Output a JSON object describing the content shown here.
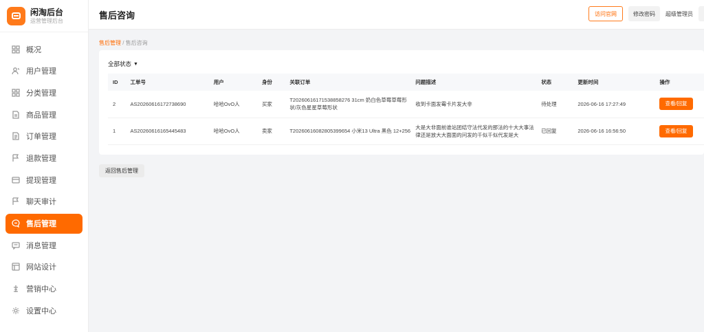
{
  "brand": {
    "title": "闲淘后台",
    "subtitle": "运营管理后台"
  },
  "sidebar": {
    "items": [
      {
        "label": "概况",
        "icon": "grid-icon",
        "active": false
      },
      {
        "label": "用户管理",
        "icon": "user-icon",
        "active": false
      },
      {
        "label": "分类管理",
        "icon": "category-icon",
        "active": false
      },
      {
        "label": "商品管理",
        "icon": "product-icon",
        "active": false
      },
      {
        "label": "订单管理",
        "icon": "order-icon",
        "active": false
      },
      {
        "label": "退款管理",
        "icon": "flag-icon",
        "active": false
      },
      {
        "label": "提现管理",
        "icon": "card-icon",
        "active": false
      },
      {
        "label": "聊天审计",
        "icon": "flag-icon",
        "active": false
      },
      {
        "label": "售后管理",
        "icon": "chat-bubble-icon",
        "active": true
      },
      {
        "label": "消息管理",
        "icon": "message-icon",
        "active": false
      },
      {
        "label": "网站设计",
        "icon": "layout-icon",
        "active": false
      },
      {
        "label": "营销中心",
        "icon": "marketing-icon",
        "active": false
      },
      {
        "label": "设置中心",
        "icon": "gear-icon",
        "active": false
      }
    ]
  },
  "header": {
    "title": "售后咨询",
    "visit_site": "访问官网",
    "change_password": "修改密码",
    "admin": "超级管理员"
  },
  "breadcrumb": {
    "parent": "售后管理",
    "separator": " / ",
    "current": "售后咨询"
  },
  "filter": {
    "status_label": "全部状态"
  },
  "table": {
    "columns": [
      "ID",
      "工单号",
      "用户",
      "身份",
      "关联订单",
      "问题描述",
      "状态",
      "更新时间",
      "操作"
    ],
    "rows": [
      {
        "id": "2",
        "ticket": "AS20260616172738690",
        "user": "哈哈OvO人",
        "role": "买家",
        "order": "T20260616171538858276 31cm 奶白色草莓草莓形状/灰色星星草莓形状",
        "issue": "收到卡面发霉卡片发大非",
        "status": "待处理",
        "updated": "2026-06-16 17:27:49",
        "action": "查看/回复"
      },
      {
        "id": "1",
        "ticket": "AS20260616165445483",
        "user": "哈哈OvO人",
        "role": "卖家",
        "order": "T20260616082805399654 小米13 Ultra 黑色 12+256",
        "issue": "大是大非面前谁站团结守法代发的那法的十大大事法律还是放大大面面的问发的千似千似代发是大",
        "status": "已回复",
        "updated": "2026-06-16 16:56:50",
        "action": "查看/回复"
      }
    ]
  },
  "footer": {
    "back": "返回售后管理"
  },
  "colors": {
    "accent": "#ff6a00"
  }
}
